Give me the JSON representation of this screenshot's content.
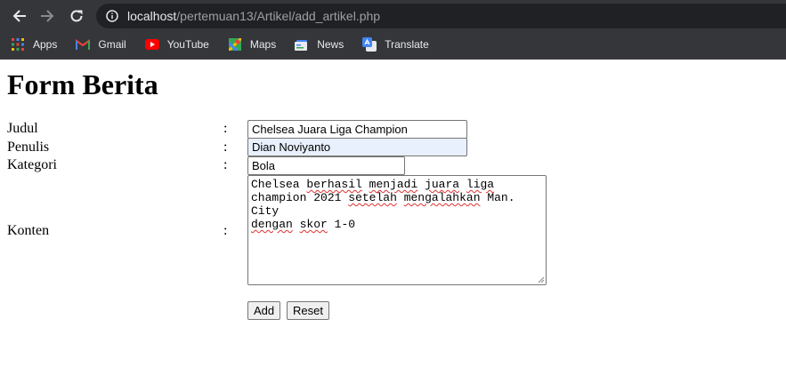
{
  "browser": {
    "url_host": "localhost",
    "url_path": "/pertemuan13/Artikel/add_artikel.php",
    "bookmarks": [
      {
        "label": "Apps",
        "icon": "apps-grid-icon"
      },
      {
        "label": "Gmail",
        "icon": "gmail-icon"
      },
      {
        "label": "YouTube",
        "icon": "youtube-icon"
      },
      {
        "label": "Maps",
        "icon": "maps-icon"
      },
      {
        "label": "News",
        "icon": "news-icon"
      },
      {
        "label": "Translate",
        "icon": "translate-icon"
      }
    ]
  },
  "form": {
    "title": "Form Berita",
    "colon": ":",
    "judul": {
      "label": "Judul",
      "value": "Chelsea Juara Liga Champion"
    },
    "penulis": {
      "label": "Penulis",
      "value": "Dian Noviyanto"
    },
    "kategori": {
      "label": "Kategori",
      "value": "Bola"
    },
    "konten": {
      "label": "Konten",
      "value": "Chelsea berhasil menjadi juara liga champion 2021 setelah mengalahkan Man. City dengan skor 1-0"
    },
    "add_label": "Add",
    "reset_label": "Reset"
  }
}
